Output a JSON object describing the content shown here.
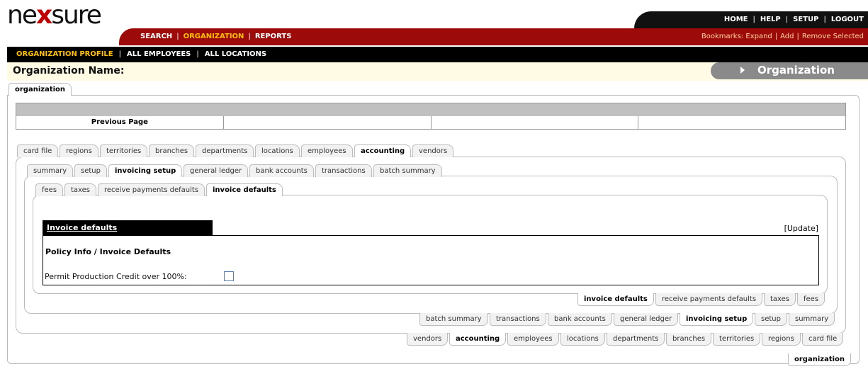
{
  "brand": {
    "logo_pre": "ne",
    "logo_x": "x",
    "logo_post": "sure"
  },
  "topnav": {
    "home": "HOME",
    "help": "HELP",
    "setup": "SETUP",
    "logout": "LOGOUT",
    "sep": "|"
  },
  "mainnav": {
    "search": "SEARCH",
    "organization": "ORGANIZATION",
    "reports": "REPORTS",
    "sep": "|"
  },
  "bookmarks": {
    "label": "Bookmarks:",
    "expand": "Expand",
    "add": "Add",
    "remove": "Remove Selected",
    "sep": "|"
  },
  "subnav": {
    "profile": "ORGANIZATION PROFILE",
    "employees": "ALL EMPLOYEES",
    "locations": "ALL LOCATIONS",
    "sep": "|"
  },
  "org": {
    "name_label": "Organization Name:",
    "section": "Organization"
  },
  "outer_tab": "organization",
  "prev_page": "Previous Page",
  "tabs_l1": [
    "card file",
    "regions",
    "territories",
    "branches",
    "departments",
    "locations",
    "employees",
    "accounting",
    "vendors"
  ],
  "tabs_l2": [
    "summary",
    "setup",
    "invoicing setup",
    "general ledger",
    "bank accounts",
    "transactions",
    "batch summary"
  ],
  "tabs_l3": [
    "fees",
    "taxes",
    "receive payments defaults",
    "invoice defaults"
  ],
  "section": {
    "title": "Invoice defaults",
    "update": "[Update]",
    "policy_title": "Policy Info / Invoice Defaults",
    "permit_label": "Permit Production Credit over 100%:",
    "permit_checked": false
  },
  "colors": {
    "brand_red": "#9c0a0a",
    "active_nav": "#ffc000",
    "black": "#000000"
  }
}
